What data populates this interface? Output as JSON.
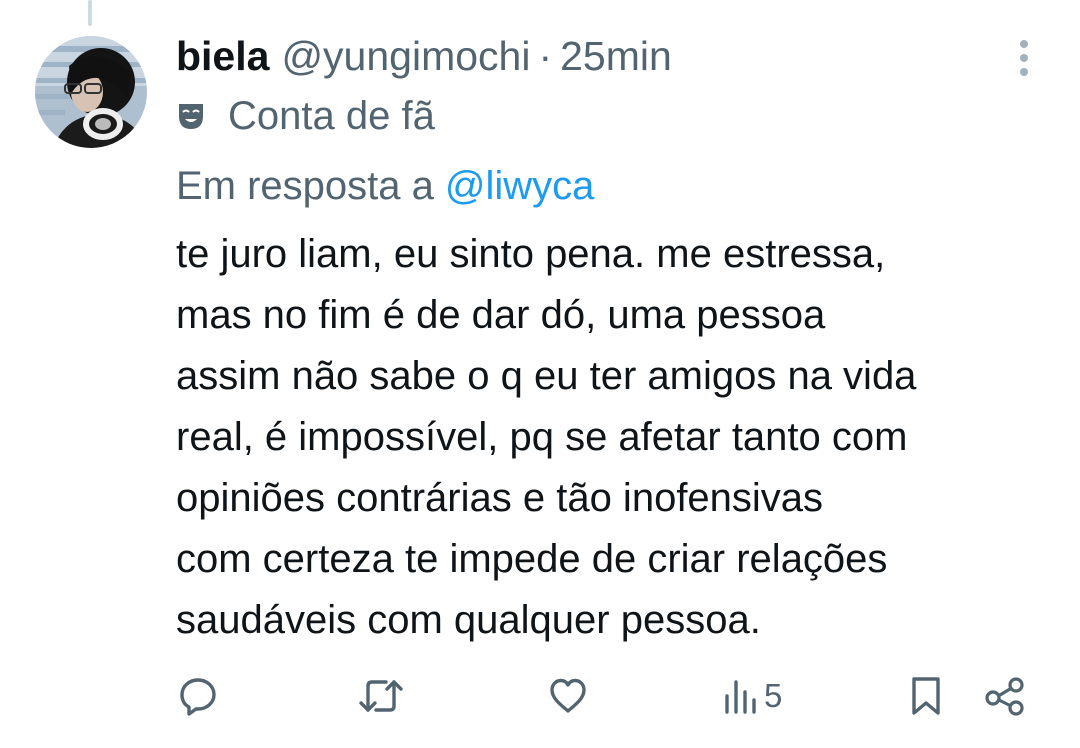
{
  "tweet": {
    "display_name": "biela",
    "handle": "@yungimochi",
    "separator": "·",
    "time": "25min",
    "label": "Conta de fã",
    "label_icon": "theater-mask-icon",
    "reply_prefix": "Em resposta a",
    "reply_to": "@liwyca",
    "text_lines": [
      "te juro liam, eu sinto pena. me estressa,",
      "mas no fim é de dar dó, uma pessoa",
      "assim não sabe o q eu ter amigos na vida",
      "real, é impossível, pq se afetar tanto com",
      "opiniões contrárias e tão inofensivas",
      "com certeza te impede de criar relações",
      "saudáveis com qualquer pessoa."
    ]
  },
  "actions": {
    "reply_icon": "reply-icon",
    "retweet_icon": "retweet-icon",
    "like_icon": "heart-icon",
    "views_icon": "views-icon",
    "views_count": "5",
    "bookmark_icon": "bookmark-icon",
    "share_icon": "share-icon"
  },
  "colors": {
    "text_primary": "#0f1419",
    "text_secondary": "#536471",
    "link": "#1d9bf0",
    "thread_line": "#cfd9de"
  }
}
